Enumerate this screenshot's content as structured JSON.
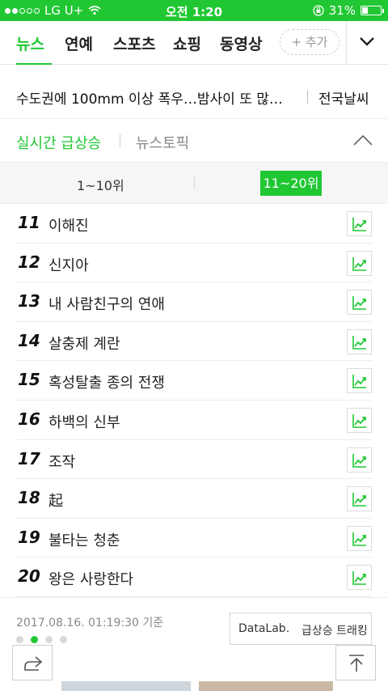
{
  "status": {
    "carrier": "LG U+",
    "time": "오전 1:20",
    "battery": "31%",
    "battery_level": 0.31
  },
  "nav": {
    "tabs": [
      {
        "label": "뉴스",
        "active": true
      },
      {
        "label": "연예",
        "active": false
      },
      {
        "label": "스포츠",
        "active": false
      },
      {
        "label": "쇼핑",
        "active": false
      },
      {
        "label": "동영상",
        "active": false
      }
    ],
    "add_label": "+ 추가"
  },
  "headline": {
    "text": "수도권에 100mm 이상 폭우…밤사이 또 많…",
    "weather": "전국날씨"
  },
  "section": {
    "tab_realtime": "실시간 급상승",
    "tab_topic": "뉴스토픽"
  },
  "range": {
    "first": "1~10위",
    "second": "11~20위",
    "selected": "11~20위"
  },
  "ranking": [
    {
      "rank": "11",
      "keyword": "이해진"
    },
    {
      "rank": "12",
      "keyword": "신지아"
    },
    {
      "rank": "13",
      "keyword": "내 사람친구의 연애"
    },
    {
      "rank": "14",
      "keyword": "살충제 계란"
    },
    {
      "rank": "15",
      "keyword": "혹성탈출 종의 전쟁"
    },
    {
      "rank": "16",
      "keyword": "하백의 신부"
    },
    {
      "rank": "17",
      "keyword": "조작"
    },
    {
      "rank": "18",
      "keyword": "起"
    },
    {
      "rank": "19",
      "keyword": "불타는 청춘"
    },
    {
      "rank": "20",
      "keyword": "왕은 사랑한다"
    }
  ],
  "footer": {
    "timestamp": "2017.08.16. 01:19:30 기준",
    "datalab_brand": "DataLab.",
    "datalab_label": "급상승 트래킹",
    "page_count": 4,
    "active_page": 2
  },
  "colors": {
    "accent": "#21c733",
    "text": "#222222",
    "muted": "#888888"
  }
}
